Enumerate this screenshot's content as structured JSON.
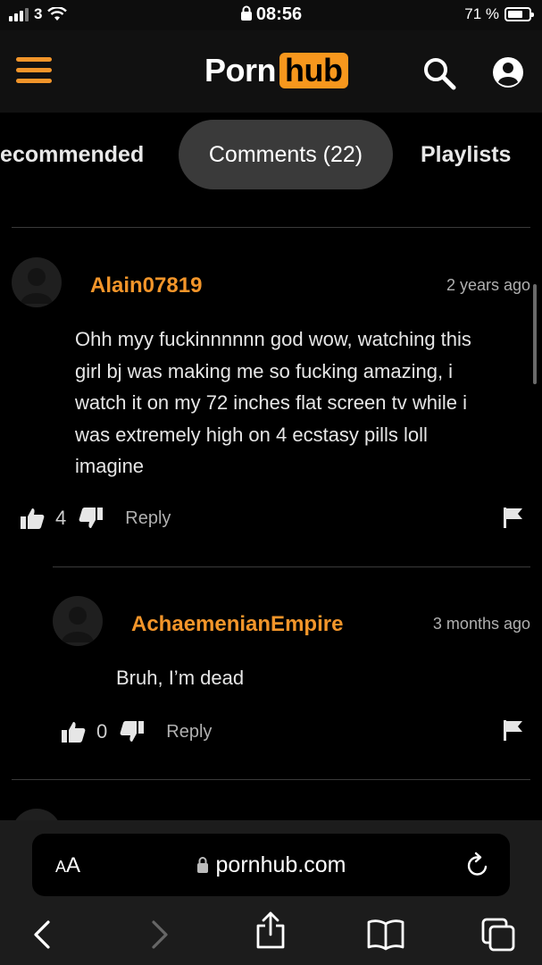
{
  "status_bar": {
    "carrier": "3",
    "time": "08:56",
    "battery": "71 %",
    "battery_level": 0.71
  },
  "header": {
    "logo_left": "Porn",
    "logo_right": "hub",
    "icons": [
      "menu-icon",
      "search-icon",
      "account-icon"
    ]
  },
  "tabs": [
    {
      "label": "Recommended"
    },
    {
      "label": "Comments (22)",
      "active": true
    },
    {
      "label": "Playlists"
    }
  ],
  "comments": [
    {
      "username": "Alain07819",
      "time": "2 years ago",
      "lines": [
        "Ohh myy fuckinnnnnn god wow, watching this",
        "girl bj was making me so fucking amazing, i",
        "watch it on my 72 inches flat screen tv while i",
        "was extremely high on 4 ecstasy pills loll",
        "imagine"
      ],
      "likes": "4",
      "reply_label": "Reply"
    },
    {
      "username": "AchaemenianEmpire",
      "time": "3 months ago",
      "lines": [
        "Bruh, I’m dead"
      ],
      "likes": "0",
      "reply_label": "Reply",
      "is_reply": true
    }
  ],
  "browser": {
    "text_size": "AA",
    "url": "pornhub.com",
    "icons": [
      "back-icon",
      "forward-icon",
      "share-icon",
      "bookmarks-icon",
      "tabs-icon"
    ]
  },
  "colors": {
    "accent": "#f2952a",
    "logo_bg": "#f7971d",
    "background": "#000000",
    "tab_active_bg": "#3a3a3a"
  }
}
